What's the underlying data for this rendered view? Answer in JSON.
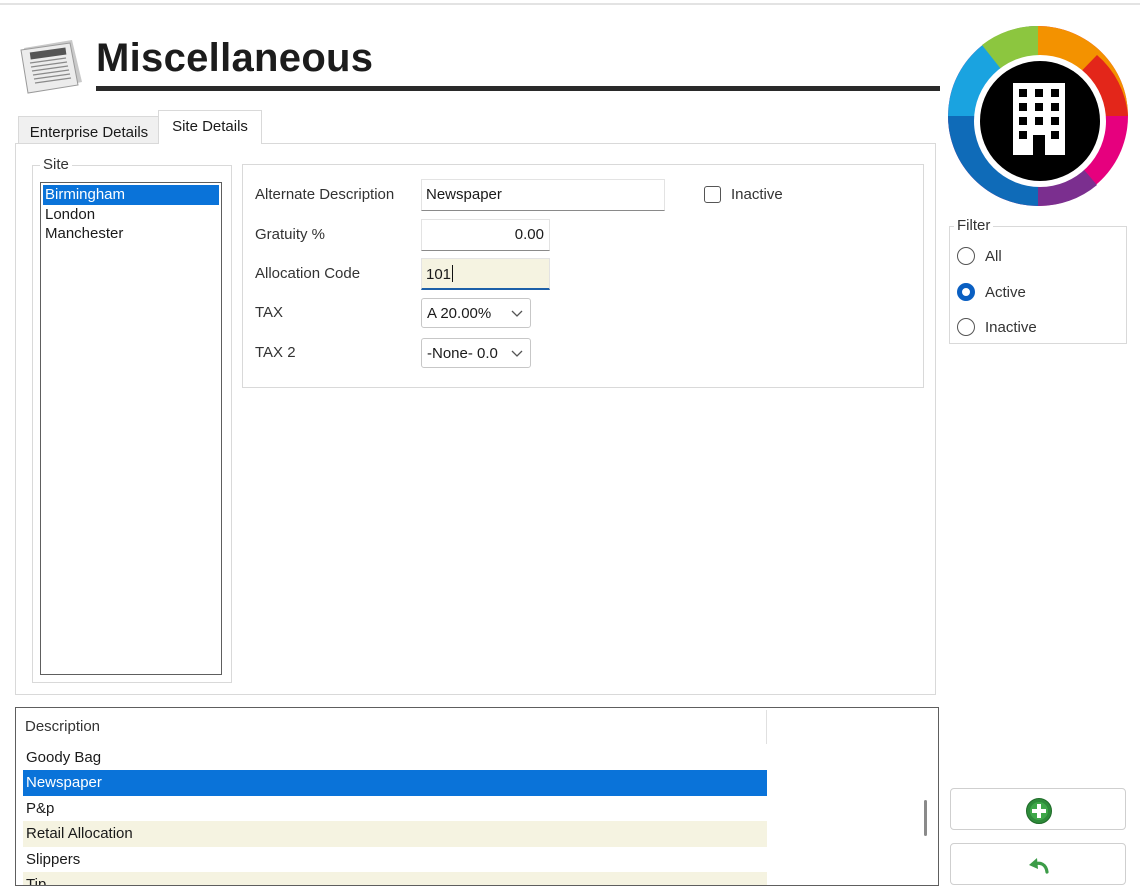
{
  "header": {
    "title": "Miscellaneous",
    "icon": "newspaper-icon",
    "logo_icon": "building-icon"
  },
  "tabs": [
    {
      "label": "Enterprise Details",
      "active": false
    },
    {
      "label": "Site Details",
      "active": true
    }
  ],
  "site": {
    "legend": "Site",
    "items": [
      "Birmingham",
      "London",
      "Manchester"
    ],
    "selected": "Birmingham"
  },
  "details": {
    "alternate_description": {
      "label": "Alternate Description",
      "value": "Newspaper"
    },
    "gratuity": {
      "label": "Gratuity %",
      "value": "0.00"
    },
    "allocation_code": {
      "label": "Allocation Code",
      "value": "101"
    },
    "tax": {
      "label": "TAX",
      "value": "A 20.00%"
    },
    "tax2": {
      "label": "TAX 2",
      "value": "-None- 0.0"
    },
    "inactive": {
      "label": "Inactive",
      "checked": false
    }
  },
  "filter": {
    "legend": "Filter",
    "options": [
      "All",
      "Active",
      "Inactive"
    ],
    "selected": "Active"
  },
  "grid": {
    "column": "Description",
    "rows": [
      "Goody Bag",
      "Newspaper",
      "P&p",
      "Retail Allocation",
      "Slippers",
      "Tip"
    ],
    "selected": "Newspaper"
  },
  "buttons": {
    "add_icon": "add-circle-icon",
    "undo_icon": "undo-arrow-icon"
  },
  "colors": {
    "selection": "#0a73d9",
    "row_alt": "#f5f3e1",
    "radio_accent": "#0a5fc2"
  }
}
